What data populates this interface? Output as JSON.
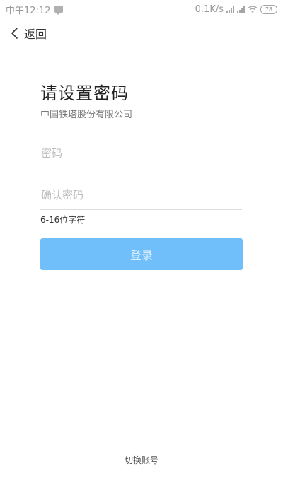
{
  "status_bar": {
    "time": "中午12:12",
    "speed": "0.1K/s",
    "battery": "78",
    "icons": [
      "message-icon",
      "signal-icon",
      "signal-icon",
      "wifi-icon",
      "battery-icon"
    ]
  },
  "nav": {
    "back_label": "返回",
    "back_icon": "chevron-left-icon"
  },
  "main": {
    "title": "请设置密码",
    "company": "中国铁塔股份有限公司",
    "password_placeholder": "密码",
    "password_value": "",
    "confirm_placeholder": "确认密码",
    "confirm_value": "",
    "hint": "6-16位字符",
    "login_label": "登录"
  },
  "footer": {
    "switch_account_label": "切换账号"
  },
  "colors": {
    "accent": "#71bffa",
    "button_text": "#d9eefe"
  }
}
